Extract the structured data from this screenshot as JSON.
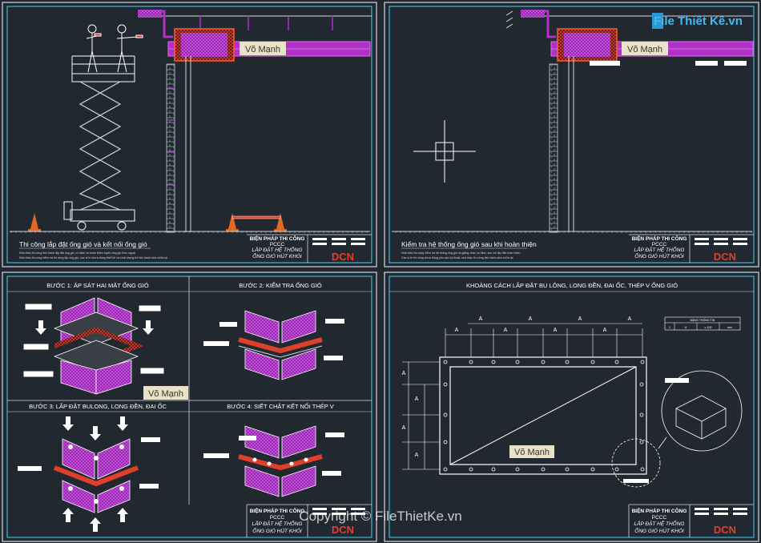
{
  "colors": {
    "background": "#212830",
    "frame_outer": "#cfd8e0",
    "frame_inner": "#3fb6d6",
    "duct_purple": "#b030c8",
    "grid_red": "#e0402a",
    "white": "#ffffff",
    "watermark_bg": "#e9e1c8"
  },
  "brand": {
    "logo_text": "File Thiết Kế.vn",
    "copyright": "Copyright © FileThietKe.vn"
  },
  "watermark": "Võ Mạnh",
  "title_block": {
    "line1": "BIỆN PHÁP THI CÔNG",
    "line2": "PCCC",
    "line3": "LẮP ĐẶT HỆ THỐNG",
    "line4": "ỐNG GIÓ HÚT KHÓI",
    "company": "DCN"
  },
  "panels": {
    "top_left": {
      "caption": "Thi công lắp đặt ống gió và kết nối ống gió",
      "notes": [
        "Nhà thầu thi công tiến hành lắp đặt ống gió, cố định và hoàn thiện tuyến ống gió theo ngoài",
        "Nhà thầu thi công kiểm tra thi công lắp ống gió, các vị trí chưa đúng thiết kế và chất lượng thi tiến hành sửa chữa lại"
      ]
    },
    "top_right": {
      "caption": "Kiểm tra hệ thống ống gió sau khi hoàn thiện",
      "notes": [
        "Nhà thầu thi công kiểm tra hệ thống ống gió và giằng chặc cố định, sau khi lắp đặt hoàn thiện",
        "Các vị trí thi công chưa đúng yêu cầu kỹ thuật, nhà thầu thi công tiến hành sửa chữa lại"
      ]
    },
    "bottom_left": {
      "steps": [
        "BƯỚC 1: ÁP SÁT HAI MẶT ỐNG GIÓ",
        "BƯỚC 2: KIỂM TRA ỐNG GIÓ",
        "BƯỚC 3: LẮP ĐẶT BULONG, LONG ĐỀN, ĐAI ỐC",
        "BƯỚC 4: SIẾT CHẶT KẾT NỐI THÉP V"
      ]
    },
    "bottom_right": {
      "title": "KHOẢNG CÁCH LẮP ĐẶT BU LÔNG, LONG ĐỀN, ĐAI ỐC, THÉP V ỐNG GIÓ",
      "dim_label": "A",
      "table_title": "BẢNG THÔNG TIN",
      "table_row": [
        "1",
        "A",
        "≤ 100",
        "mm"
      ]
    }
  }
}
